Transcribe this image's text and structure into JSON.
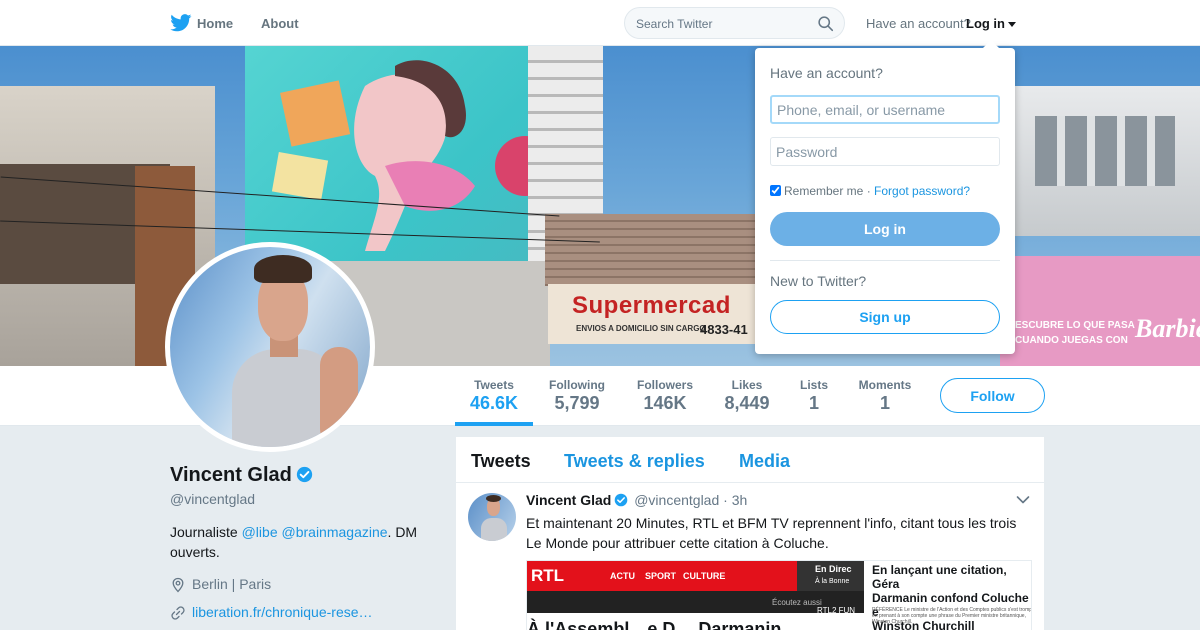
{
  "colors": {
    "brand": "#1da1f2",
    "link": "#1b95e0",
    "background": "#e6ecf0",
    "text": "#14171a",
    "muted": "#657786"
  },
  "topnav": {
    "icon": "twitter-bird-icon",
    "home_label": "Home",
    "about_label": "About",
    "search_placeholder": "Search Twitter",
    "have_account_label": "Have an account?",
    "login_label": "Log in"
  },
  "banner": {
    "sign_text": "Supermercad",
    "sign_subtext": "ENVIOS A DOMICILIO SIN CARGO",
    "sign_number": "4833-41",
    "pink_text": "ESCUBRE LO QUE PASA\nCUANDO JUEGAS CON",
    "brand_text": "Barbie"
  },
  "profile": {
    "name": "Vincent Glad",
    "handle": "@vincentglad",
    "bio_prefix": "Journaliste ",
    "bio_mention_1": "@libe",
    "bio_mention_2": "@brainmagazine",
    "bio_suffix": ". DM ouverts.",
    "location": "Berlin | Paris",
    "website": "liberation.fr/chronique-rese…"
  },
  "stats": [
    {
      "label": "Tweets",
      "value": "46.6K"
    },
    {
      "label": "Following",
      "value": "5,799"
    },
    {
      "label": "Followers",
      "value": "146K"
    },
    {
      "label": "Likes",
      "value": "8,449"
    },
    {
      "label": "Lists",
      "value": "1"
    },
    {
      "label": "Moments",
      "value": "1"
    }
  ],
  "follow_label": "Follow",
  "timeline": {
    "tabs": [
      "Tweets",
      "Tweets & replies",
      "Media"
    ],
    "tweet": {
      "name": "Vincent Glad",
      "handle": "@vincentglad",
      "dot": "·",
      "time": "3h",
      "text": "Et maintenant 20 Minutes, RTL et BFM TV reprennent l'info, citant tous les trois Le Monde pour attribuer cette citation à Coluche.",
      "media": {
        "logo": "RTL",
        "menu": [
          "ACTU",
          "SPORT",
          "CULTURE"
        ],
        "live_line1": "En Direc",
        "live_line2": "À la Bonne",
        "listen": "Écoutez aussi",
        "channels": "RTL2   FUN",
        "headline": "À l'Assembl…e D… Darmanin",
        "article_title": "En lançant une citation, Géra\nDarmanin confond Coluche e\nWinston Churchill",
        "article_small": "RÉFÉRENCE Le ministre de l'Action et des Comptes publics s'est trompé en prenant à son compte une phrase du Premier ministre britannique, Winston Churchill."
      }
    }
  },
  "login_dropdown": {
    "heading": "Have an account?",
    "username_placeholder": "Phone, email, or username",
    "password_placeholder": "Password",
    "remember_label": "Remember me",
    "separator": " · ",
    "forgot_label": "Forgot password?",
    "login_button": "Log in",
    "new_label": "New to Twitter?",
    "signup_button": "Sign up"
  }
}
